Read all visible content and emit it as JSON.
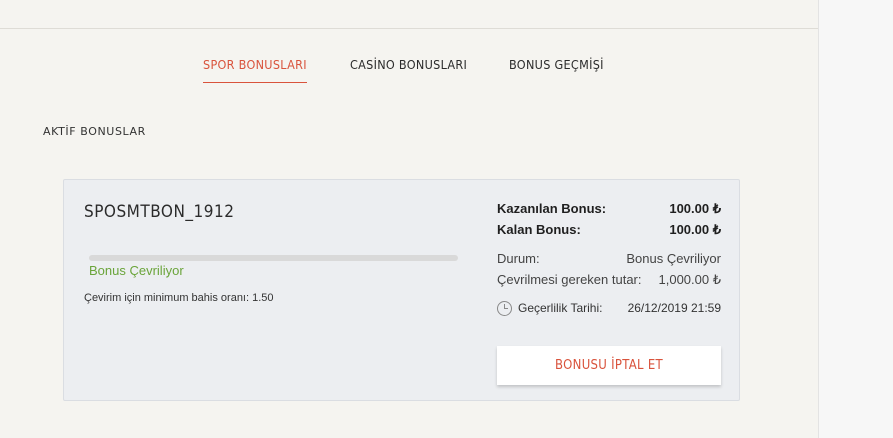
{
  "tabs": [
    {
      "label": "SPOR BONUSLARI",
      "active": true
    },
    {
      "label": "CASİNO BONUSLARI",
      "active": false
    },
    {
      "label": "BONUS GEÇMİŞİ",
      "active": false
    }
  ],
  "section_title": "AKTİF BONUSLAR",
  "bonus": {
    "code": "SPOSMTBON_1912",
    "progress": 0.0,
    "status_text": "Bonus Çevriliyor",
    "min_odds_text": "Çevirim için minimum bahis oranı: 1.50",
    "earned_label": "Kazanılan Bonus:",
    "earned_value": "100.00 ₺",
    "remaining_label": "Kalan Bonus:",
    "remaining_value": "100.00 ₺",
    "status_label": "Durum:",
    "status_value": "Bonus Çevriliyor",
    "required_label": "Çevrilmesi gereken tutar:",
    "required_value": "1,000.00 ₺",
    "validity_label": "Geçerlilik Tarihi:",
    "validity_value": "26/12/2019 21:59",
    "cancel_label": "BONUSU İPTAL ET",
    "validity_icon": "clock-icon"
  },
  "colors": {
    "accent": "#d9533c",
    "status_green": "#6aa43a",
    "card_bg": "#eceef1",
    "page_bg": "#f5f4f0"
  }
}
